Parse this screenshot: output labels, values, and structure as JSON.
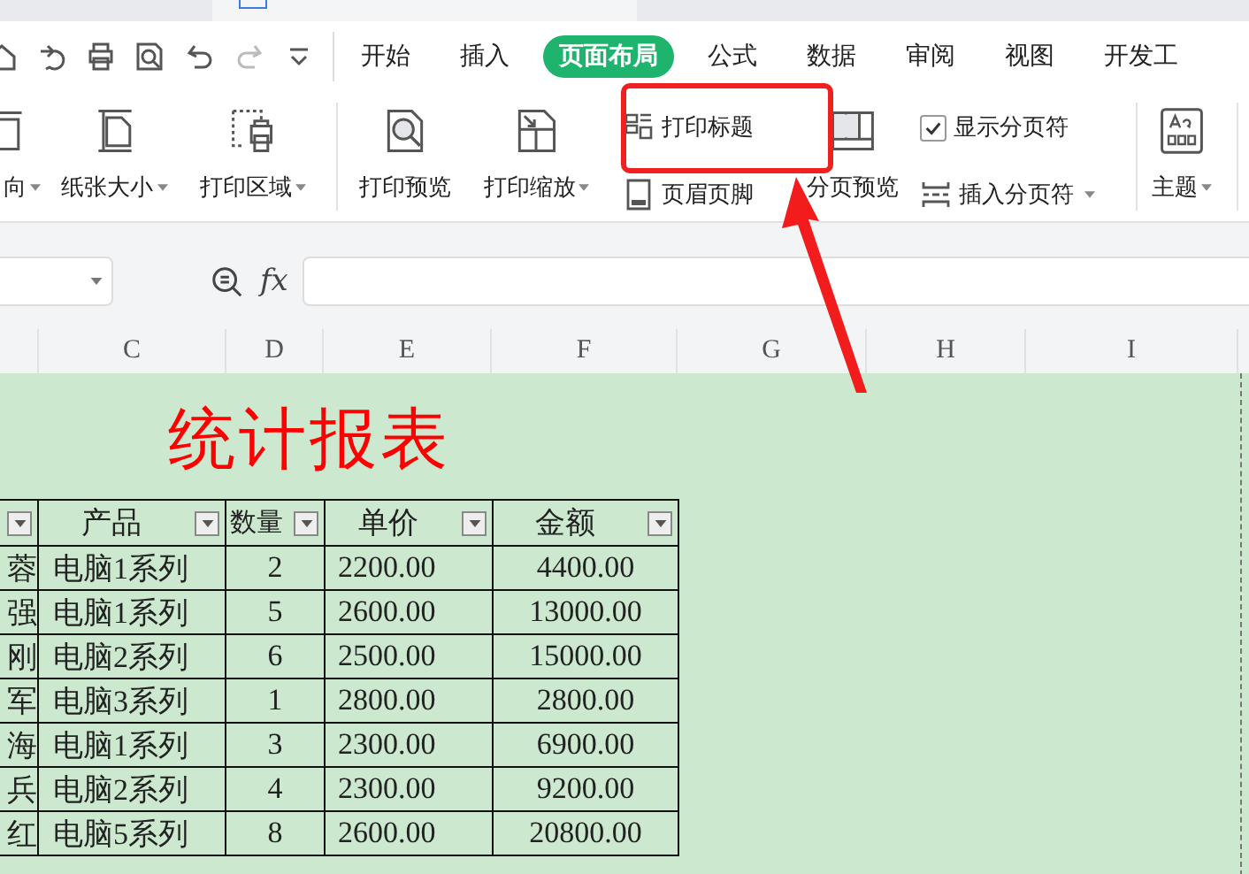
{
  "menu_tabs": [
    {
      "label": "开始",
      "selected": false
    },
    {
      "label": "插入",
      "selected": false
    },
    {
      "label": "页面布局",
      "selected": true
    },
    {
      "label": "公式",
      "selected": false
    },
    {
      "label": "数据",
      "selected": false
    },
    {
      "label": "审阅",
      "selected": false
    },
    {
      "label": "视图",
      "selected": false
    },
    {
      "label": "开发工",
      "selected": false
    }
  ],
  "ribbon": [
    {
      "kind": "large",
      "label": "向",
      "dropdown": true
    },
    {
      "kind": "large",
      "label": "纸张大小",
      "dropdown": true
    },
    {
      "kind": "large",
      "label": "打印区域",
      "dropdown": true
    },
    {
      "kind": "separator"
    },
    {
      "kind": "large",
      "label": "打印预览",
      "dropdown": false
    },
    {
      "kind": "large",
      "label": "打印缩放",
      "dropdown": true
    },
    {
      "kind": "stack",
      "items": [
        {
          "kind": "small",
          "label": "打印标题",
          "dropdown": false
        },
        {
          "kind": "small",
          "label": "页眉页脚",
          "dropdown": false
        }
      ]
    },
    {
      "kind": "large",
      "label": "分页预览",
      "dropdown": false
    },
    {
      "kind": "stack",
      "items": [
        {
          "kind": "check",
          "label": "显示分页符",
          "checked": true
        },
        {
          "kind": "small",
          "label": "插入分页符",
          "dropdown": true
        }
      ]
    },
    {
      "kind": "separator"
    },
    {
      "kind": "large",
      "label": "主题",
      "dropdown": true
    }
  ],
  "formula_bar": {
    "fx_label": "fx"
  },
  "column_headers": [
    "C",
    "D",
    "E",
    "F",
    "G",
    "H",
    "I"
  ],
  "sheet": {
    "title": "统计报表",
    "table": {
      "columns": [
        {
          "filter": true
        },
        {
          "label": "产品",
          "filter": true
        },
        {
          "label": "数量",
          "filter": true
        },
        {
          "label": "单价",
          "filter": true
        },
        {
          "label": "金额",
          "filter": true
        }
      ],
      "rows": [
        [
          "蓉",
          "电脑1系列",
          "2",
          "2200.00",
          "4400.00"
        ],
        [
          "强",
          "电脑1系列",
          "5",
          "2600.00",
          "13000.00"
        ],
        [
          "刚",
          "电脑2系列",
          "6",
          "2500.00",
          "15000.00"
        ],
        [
          "军",
          "电脑3系列",
          "1",
          "2800.00",
          "2800.00"
        ],
        [
          "海",
          "电脑1系列",
          "3",
          "2300.00",
          "6900.00"
        ],
        [
          "兵",
          "电脑2系列",
          "4",
          "2300.00",
          "9200.00"
        ],
        [
          "红",
          "电脑5系列",
          "8",
          "2600.00",
          "20800.00"
        ]
      ]
    }
  }
}
